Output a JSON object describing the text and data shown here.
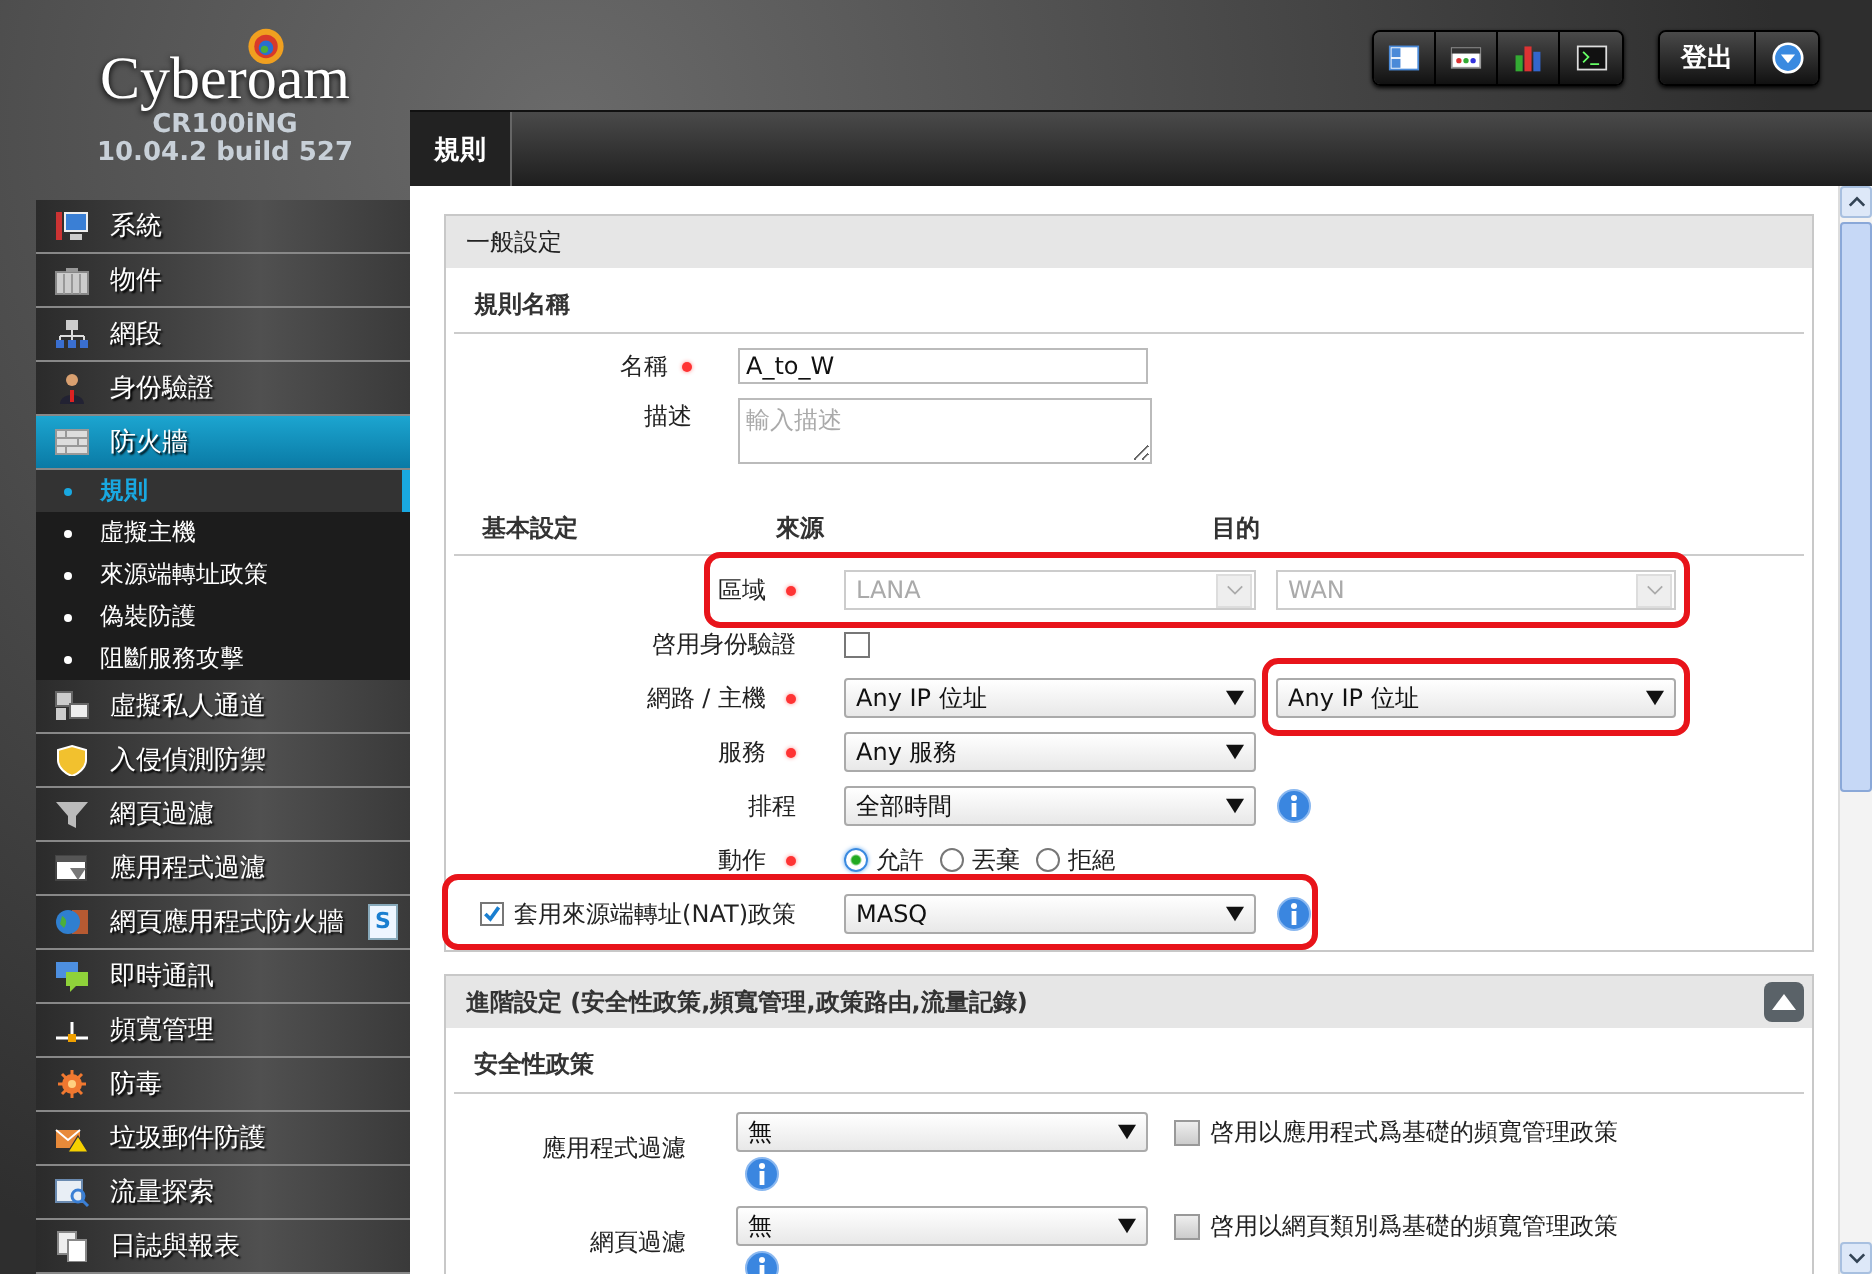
{
  "brand": {
    "name": "Cyberoam",
    "model": "CR100iNG",
    "version": "10.04.2 build 527"
  },
  "toolbar": {
    "logout": "登出"
  },
  "nav": [
    {
      "label": "系統",
      "selected": false
    },
    {
      "label": "物件",
      "selected": false
    },
    {
      "label": "網段",
      "selected": false
    },
    {
      "label": "身份驗證",
      "selected": false
    },
    {
      "label": "防火牆",
      "selected": true,
      "children": [
        {
          "label": "規則",
          "selected": true
        },
        {
          "label": "虛擬主機",
          "selected": false
        },
        {
          "label": "來源端轉址政策",
          "selected": false
        },
        {
          "label": "偽裝防護",
          "selected": false
        },
        {
          "label": "阻斷服務攻擊",
          "selected": false
        }
      ]
    },
    {
      "label": "虛擬私人通道",
      "selected": false
    },
    {
      "label": "入侵偵測防禦",
      "selected": false
    },
    {
      "label": "網頁過濾",
      "selected": false
    },
    {
      "label": "應用程式過濾",
      "selected": false
    },
    {
      "label": "網頁應用程式防火牆",
      "selected": false,
      "badge": "S"
    },
    {
      "label": "即時通訊",
      "selected": false
    },
    {
      "label": "頻寬管理",
      "selected": false
    },
    {
      "label": "防毒",
      "selected": false
    },
    {
      "label": "垃圾郵件防護",
      "selected": false
    },
    {
      "label": "流量探索",
      "selected": false
    },
    {
      "label": "日誌與報表",
      "selected": false
    }
  ],
  "tabs": [
    {
      "label": "規則",
      "selected": true
    }
  ],
  "general": {
    "title": "一般設定",
    "section": "規則名稱",
    "name": {
      "label": "名稱",
      "required": true,
      "value": "A_to_W"
    },
    "description": {
      "label": "描述",
      "placeholder": "輸入描述"
    }
  },
  "basic": {
    "title": "基本設定",
    "source_heading": "來源",
    "destination_heading": "目的",
    "rows": [
      {
        "kind": "zone",
        "label": "區域",
        "required": true,
        "source": "LANA",
        "destination": "WAN",
        "disabled": true,
        "highlighted": true
      },
      {
        "kind": "checkbox",
        "label": "啓用身份驗證",
        "checked": false
      },
      {
        "kind": "select",
        "label": "網路 / 主機",
        "required": true,
        "source": "Any IP 位址",
        "destination": "Any IP 位址",
        "destination_highlighted": true
      },
      {
        "kind": "select",
        "label": "服務",
        "required": true,
        "source": "Any 服務"
      },
      {
        "kind": "select",
        "label": "排程",
        "source": "全部時間",
        "info": true
      },
      {
        "kind": "radio",
        "label": "動作",
        "required": true,
        "options": [
          {
            "label": "允許",
            "selected": true
          },
          {
            "label": "丟棄",
            "selected": false
          },
          {
            "label": "拒絕",
            "selected": false
          }
        ]
      },
      {
        "kind": "nat",
        "label": "套用來源端轉址(NAT)政策",
        "checked": true,
        "value": "MASQ",
        "info": true,
        "highlighted": true
      }
    ]
  },
  "advanced": {
    "title": "進階設定 (安全性政策,頻寬管理,政策路由,流量記錄)",
    "expanded": true,
    "section": "安全性政策",
    "rows": [
      {
        "label": "應用程式過濾",
        "value": "無",
        "info": true,
        "option": {
          "label": "啓用以應用程式爲基礎的頻寬管理政策",
          "checked": false
        }
      },
      {
        "label": "網頁過濾",
        "value": "無",
        "info": true,
        "option": {
          "label": "啓用以網頁類別爲基礎的頻寬管理政策",
          "checked": false
        }
      }
    ]
  }
}
